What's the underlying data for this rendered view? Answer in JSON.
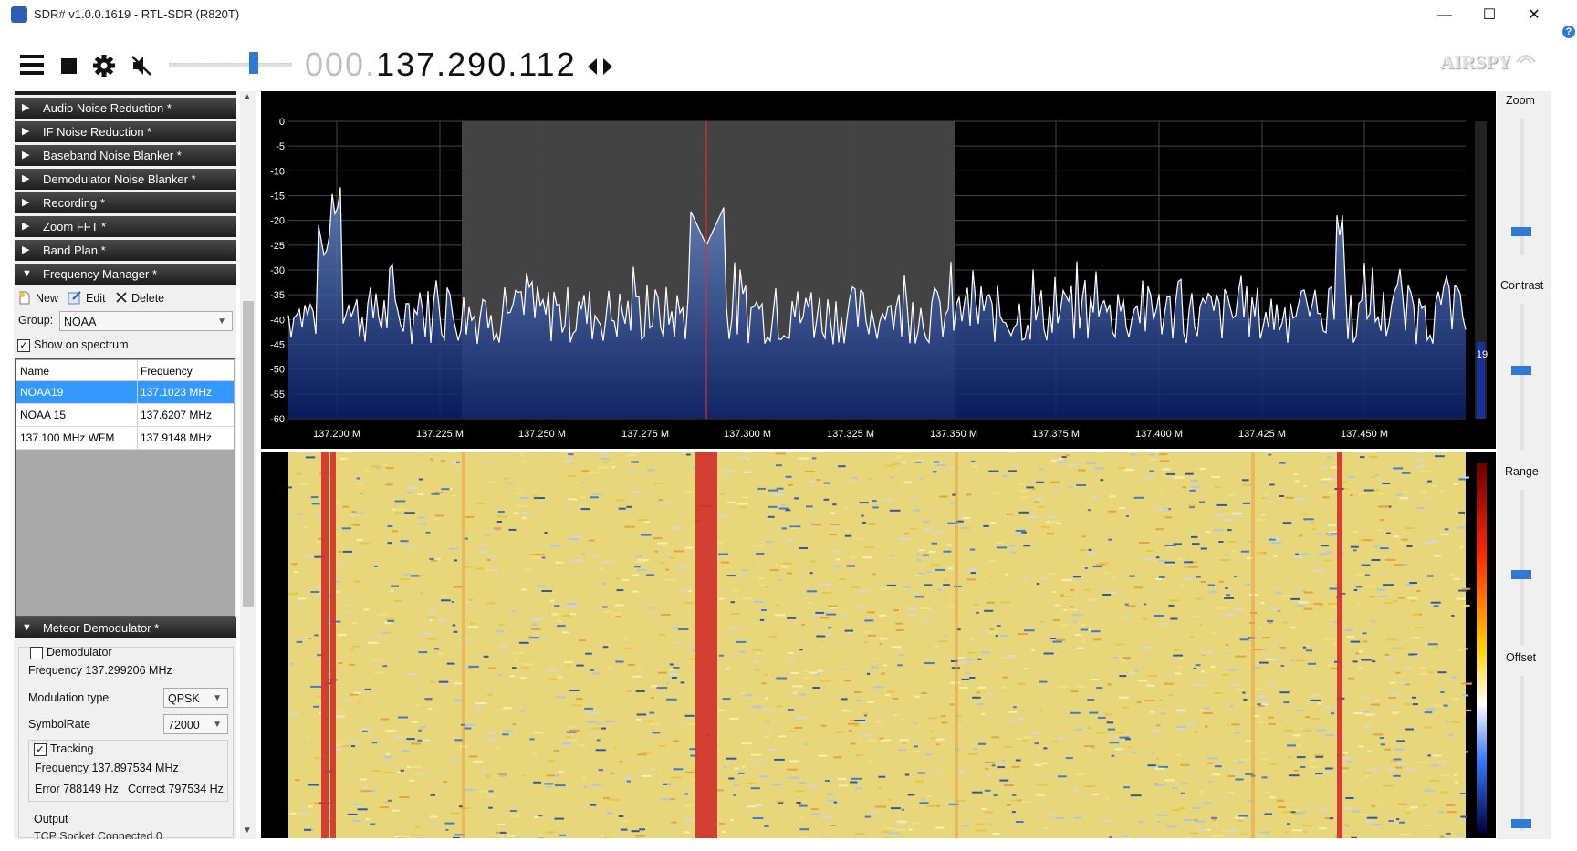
{
  "window": {
    "title": "SDR# v1.0.0.1619 - RTL-SDR (R820T)",
    "minimize": "—",
    "maximize": "☐",
    "close": "✕"
  },
  "toolbar": {
    "frequency_prefix": "000.",
    "frequency_main": "137.290.112",
    "brand": "AIRSPY",
    "volume_level": 0.7
  },
  "sidebar": {
    "categories": [
      {
        "label": "Audio Noise Reduction *",
        "expanded": false
      },
      {
        "label": "IF Noise Reduction *",
        "expanded": false
      },
      {
        "label": "Baseband Noise Blanker *",
        "expanded": false
      },
      {
        "label": "Demodulator Noise Blanker *",
        "expanded": false
      },
      {
        "label": "Recording *",
        "expanded": false
      },
      {
        "label": "Zoom FFT *",
        "expanded": false
      },
      {
        "label": "Band Plan *",
        "expanded": false
      },
      {
        "label": "Frequency Manager *",
        "expanded": true
      }
    ],
    "frequency_manager": {
      "new_label": "New",
      "edit_label": "Edit",
      "delete_label": "Delete",
      "group_label": "Group:",
      "group_value": "NOAA",
      "show_on_spectrum_label": "Show on spectrum",
      "show_on_spectrum_checked": true,
      "columns": [
        "Name",
        "Frequency"
      ],
      "rows": [
        {
          "name": "NOAA19",
          "frequency": "137.1023 MHz",
          "selected": true
        },
        {
          "name": "NOAA 15",
          "frequency": "137.6207 MHz",
          "selected": false
        },
        {
          "name": "137.100 MHz WFM",
          "frequency": "137.9148 MHz",
          "selected": false
        }
      ]
    },
    "meteor": {
      "header": "Meteor Demodulator *",
      "demodulator_label": "Demodulator",
      "demodulator_checked": false,
      "frequency_text": "Frequency 137.299206 MHz",
      "modulation_label": "Modulation type",
      "modulation_value": "QPSK",
      "symbolrate_label": "SymbolRate",
      "symbolrate_value": "72000",
      "tracking_label": "Tracking",
      "tracking_checked": true,
      "tracking_frequency": "Frequency 137.897534 MHz",
      "error_text": "Error 788149 Hz",
      "correct_text": "Correct 797534 Hz",
      "output_label": "Output",
      "tcp_text": "TCP Socket    Connected 0"
    }
  },
  "spectrum": {
    "y_ticks": [
      "0",
      "-5",
      "-10",
      "-15",
      "-20",
      "-25",
      "-30",
      "-35",
      "-40",
      "-45",
      "-50",
      "-55",
      "-60"
    ],
    "x_ticks": [
      "137.200 M",
      "137.225 M",
      "137.250 M",
      "137.275 M",
      "137.300 M",
      "137.325 M",
      "137.350 M",
      "137.375 M",
      "137.400 M",
      "137.425 M",
      "137.450 M"
    ],
    "snr_value": "19",
    "colors": {
      "trace": "#ffffff",
      "fill_top": "#6b8ec9",
      "fill_bottom": "#0a1f6a",
      "tuner_line": "#ff2020",
      "passband": "#5a5a5a"
    }
  },
  "right_panel": {
    "zoom_label": "Zoom",
    "contrast_label": "Contrast",
    "range_label": "Range",
    "offset_label": "Offset",
    "zoom_level": 0.15,
    "contrast_level": 0.55,
    "range_level": 0.45,
    "offset_level": 0.02
  }
}
